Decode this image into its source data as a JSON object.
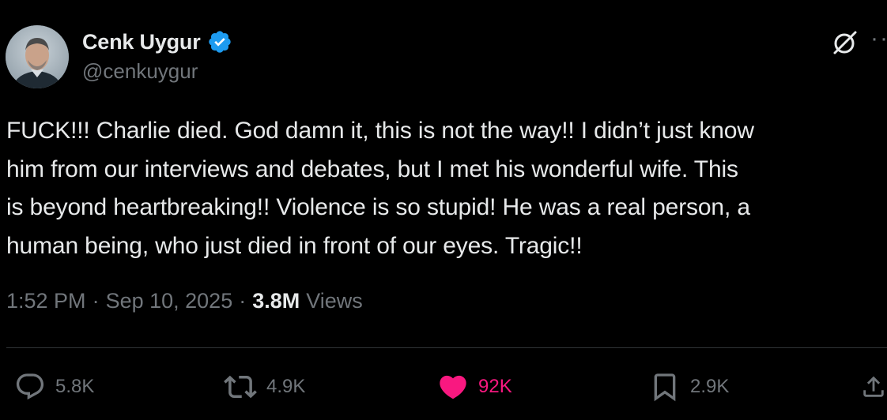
{
  "author": {
    "display_name": "Cenk Uygur",
    "handle": "@cenkuygur",
    "verified": true,
    "verified_color": "#1d9bf0"
  },
  "header_actions": {
    "grok_icon": "grok-icon",
    "more_label": "··"
  },
  "tweet": {
    "text": "FUCK!!! Charlie died. God damn it, this is not the way!! I didn’t just know\nhim from our interviews and debates, but I met his wonderful wife. This\nis beyond heartbreaking!! Violence is so stupid! He was a real person, a\nhuman being, who just died in front of our eyes. Tragic!!"
  },
  "meta": {
    "time": "1:52 PM",
    "separator": "·",
    "date": "Sep 10, 2025",
    "views_count": "3.8M",
    "views_label": "Views"
  },
  "actions": {
    "replies": "5.8K",
    "reposts": "4.9K",
    "likes": "92K",
    "bookmarks": "2.9K",
    "like_color": "#f91880",
    "icon_color": "#71767b"
  }
}
